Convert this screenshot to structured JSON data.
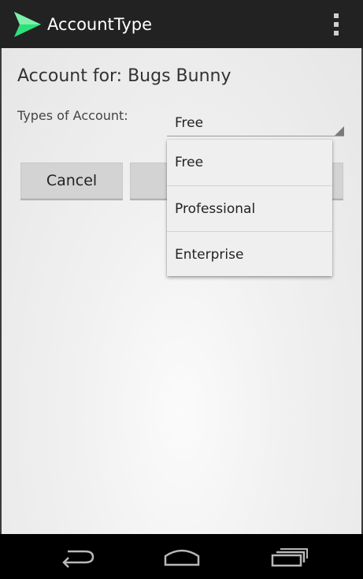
{
  "app": {
    "title": "AccountType",
    "icon": "send-arrow-icon",
    "accent_color": "#2ee07a"
  },
  "form": {
    "heading": "Account for: Bugs Bunny",
    "types_label": "Types of Account:",
    "selected_type": "Free"
  },
  "buttons": {
    "cancel_label": "Cancel",
    "ok_label": ""
  },
  "dropdown": {
    "options": [
      "Free",
      "Professional",
      "Enterprise"
    ]
  },
  "nav": {
    "back_icon": "back-icon",
    "home_icon": "home-icon",
    "recent_icon": "recent-apps-icon"
  }
}
